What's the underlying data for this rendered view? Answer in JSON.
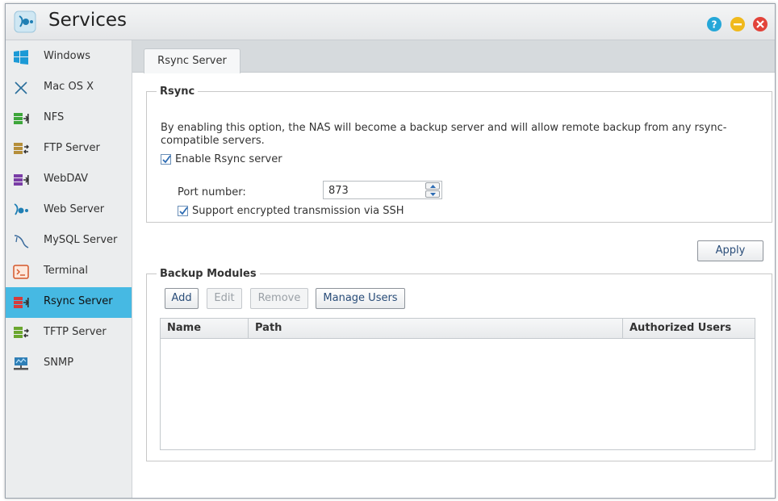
{
  "window": {
    "title": "Services",
    "app_icon": "services-icon",
    "controls": [
      "help-icon",
      "minimize-icon",
      "close-icon"
    ]
  },
  "sidebar": {
    "items": [
      {
        "label": "Windows",
        "icon": "windows-icon",
        "active": false
      },
      {
        "label": "Mac OS X",
        "icon": "mac-os-x-icon",
        "active": false
      },
      {
        "label": "NFS",
        "icon": "nfs-icon",
        "active": false
      },
      {
        "label": "FTP Server",
        "icon": "ftp-server-icon",
        "active": false
      },
      {
        "label": "WebDAV",
        "icon": "webdav-icon",
        "active": false
      },
      {
        "label": "Web Server",
        "icon": "web-server-icon",
        "active": false
      },
      {
        "label": "MySQL Server",
        "icon": "mysql-server-icon",
        "active": false
      },
      {
        "label": "Terminal",
        "icon": "terminal-icon",
        "active": false
      },
      {
        "label": "Rsync Server",
        "icon": "rsync-server-icon",
        "active": true
      },
      {
        "label": "TFTP Server",
        "icon": "tftp-server-icon",
        "active": false
      },
      {
        "label": "SNMP",
        "icon": "snmp-icon",
        "active": false
      }
    ]
  },
  "tabs": [
    {
      "label": "Rsync Server",
      "active": true
    }
  ],
  "rsync": {
    "legend": "Rsync",
    "description": "By enabling this option, the NAS will become a backup server and will allow remote backup from any rsync-compatible servers.",
    "enable_label": "Enable Rsync server",
    "enable_checked": true,
    "port_label": "Port number:",
    "port_value": "873",
    "ssh_label": "Support encrypted transmission via SSH",
    "ssh_checked": true
  },
  "apply_label": "Apply",
  "backup_modules": {
    "legend": "Backup Modules",
    "buttons": {
      "add": "Add",
      "edit": "Edit",
      "remove": "Remove",
      "manage_users": "Manage Users"
    },
    "columns": [
      "Name",
      "Path",
      "Authorized Users"
    ],
    "rows": []
  },
  "colors": {
    "accent": "#46b9e3",
    "sidebar_bg": "#ebedee",
    "button_text": "#2a4d79"
  }
}
